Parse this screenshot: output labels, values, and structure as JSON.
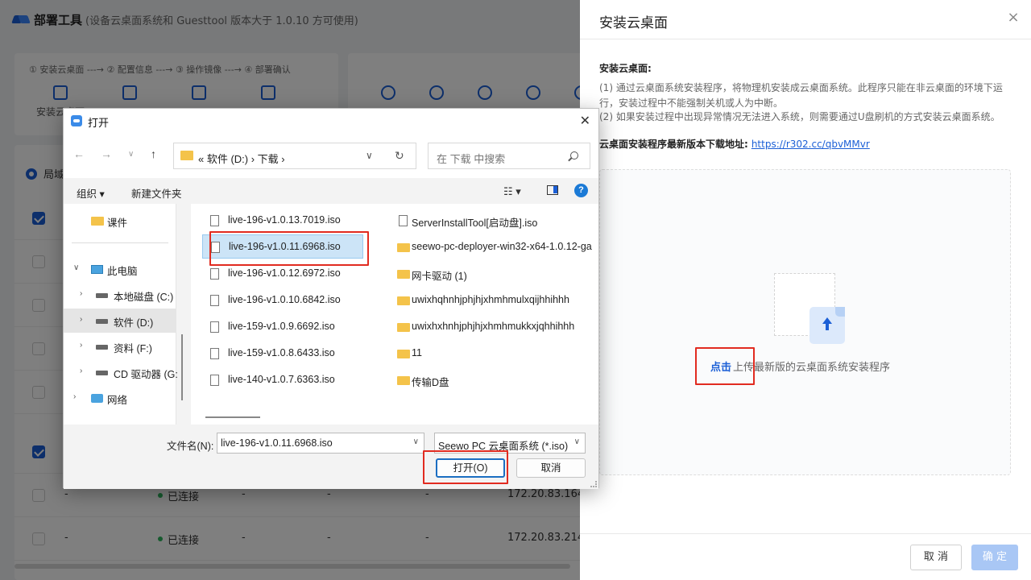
{
  "app": {
    "title": "部署工具",
    "subtitle": "(设备云桌面系统和 Guesttool 版本大于 1.0.10 方可使用)",
    "steps": "① 安装云桌面 ---→ ② 配置信息 ---→ ③ 操作镜像 ---→ ④ 部署确认",
    "tools": [
      "安装云桌面"
    ],
    "radio_label": "局域",
    "rows": [
      {
        "name": "-",
        "status": "已连接",
        "c3": "-",
        "c4": "-",
        "c5": "-",
        "ip": "172.20.83.164"
      },
      {
        "name": "-",
        "status": "已连接",
        "c3": "-",
        "c4": "-",
        "c5": "-",
        "ip": "172.20.83.214"
      }
    ]
  },
  "drawer": {
    "title": "安装云桌面",
    "close_icon": "close-icon",
    "section_label": "安装云桌面:",
    "para1": "(1) 通过云桌面系统安装程序，将物理机安装成云桌面系统。此程序只能在非云桌面的环境下运行，安装过程中不能强制关机或人为中断。",
    "para2": "(2) 如果安装过程中出现异常情况无法进入系统，则需要通过U盘刷机的方式安装云桌面系统。",
    "link_label": "云桌面安装程序最新版本下载地址:",
    "link_text": "https://r302.cc/qbvMMvr",
    "upload_link": "点击",
    "upload_rest": "上传最新版的云桌面系统安装程序",
    "cancel_label": "取 消",
    "ok_label": "确 定"
  },
  "dialog": {
    "title": "打开",
    "breadcrumb": "«  软件 (D:)  ›  下载  ›",
    "search_placeholder": "在 下载 中搜索",
    "organize_label": "组织 ▾",
    "new_folder_label": "新建文件夹",
    "tree": [
      {
        "label": "课件",
        "icon": "folder-icon"
      },
      {
        "label": "此电脑",
        "icon": "computer-icon"
      },
      {
        "label": "本地磁盘 (C:)",
        "icon": "drive-icon"
      },
      {
        "label": "软件 (D:)",
        "icon": "drive-icon"
      },
      {
        "label": "资料 (F:)",
        "icon": "drive-icon"
      },
      {
        "label": "CD 驱动器 (G:",
        "icon": "cd-drive-icon"
      },
      {
        "label": "网络",
        "icon": "network-icon"
      }
    ],
    "files_col1": [
      "live-196-v1.0.13.7019.iso",
      "live-196-v1.0.11.6968.iso",
      "live-196-v1.0.12.6972.iso",
      "live-196-v1.0.10.6842.iso",
      "live-159-v1.0.9.6692.iso",
      "live-159-v1.0.8.6433.iso",
      "live-140-v1.0.7.6363.iso"
    ],
    "files_col2": [
      "ServerInstallTool[启动盘].iso",
      "seewo-pc-deployer-win32-x64-1.0.12-ga",
      "网卡驱动 (1)",
      "uwixhqhnhjphjhjxhmhmulxqijhhihhh",
      "uwixhxhnhjphjhjxhmhmukkxjqhhihhh",
      "11",
      "传输D盘"
    ],
    "filename_label": "文件名(N):",
    "filename_value": "live-196-v1.0.11.6968.iso",
    "filetype_value": "Seewo PC 云桌面系统 (*.iso)",
    "open_label": "打开(O)",
    "cancel_label": "取消"
  }
}
